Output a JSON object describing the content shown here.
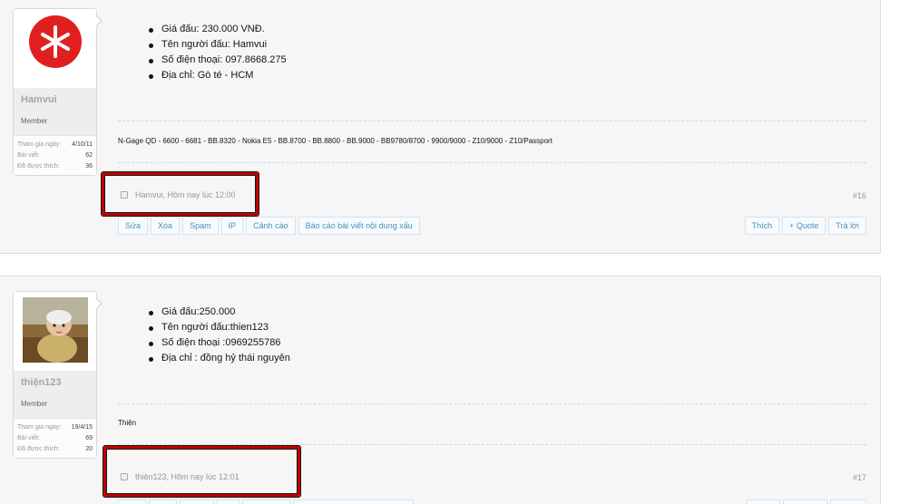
{
  "posts": [
    {
      "user": {
        "avatar": "red-circle-asterisk-icon",
        "name": "Hamvui",
        "title": "Member",
        "stats": [
          {
            "label": "Tham gia ngày:",
            "value": "4/10/11"
          },
          {
            "label": "Bài viết:",
            "value": "62"
          },
          {
            "label": "Đã được thích:",
            "value": "36"
          }
        ]
      },
      "bullets": [
        "Giá đấu: 230.000 VNĐ.",
        "Tên người đấu: Hamvui",
        "Số điện thoại: 097.8668.275",
        "Địa chỉ: Gò té - HCM"
      ],
      "signature": "N-Gage QD - 6600 - 6681 - BB.8320 - Nokia E5 - BB.8700 - BB.8800 - BB.9000 - BB9780/8700 - 9900/9000 - Z10/9000 - Z10/Passport",
      "meta": "Hamvui, Hôm nay lúc 12:00",
      "number": "#16",
      "actions_left": [
        "Sửa",
        "Xóa",
        "Spam",
        "IP",
        "Cảnh cáo",
        "Báo cáo bài viết nội dung xấu"
      ],
      "actions_right": [
        "Thích",
        "+ Quote",
        "Trả lời"
      ]
    },
    {
      "user": {
        "avatar": "baby-photo",
        "name": "thiện123",
        "title": "Member",
        "stats": [
          {
            "label": "Tham gia ngày:",
            "value": "19/4/15"
          },
          {
            "label": "Bài viết:",
            "value": "69"
          },
          {
            "label": "Đã được thích:",
            "value": "20"
          }
        ]
      },
      "bullets": [
        "Giá đấu:250.000",
        "Tên người đấu:thien123",
        "Số điện thoại :0969255786",
        "Địa chỉ : đồng hỷ thái nguyên"
      ],
      "signature": "Thiện",
      "meta": "thiện123, Hôm nay lúc 12:01",
      "number": "#17"
    }
  ],
  "colors": {
    "highlight": "#c00000",
    "link": "#4a8fb8",
    "avatar_red": "#e02020"
  }
}
